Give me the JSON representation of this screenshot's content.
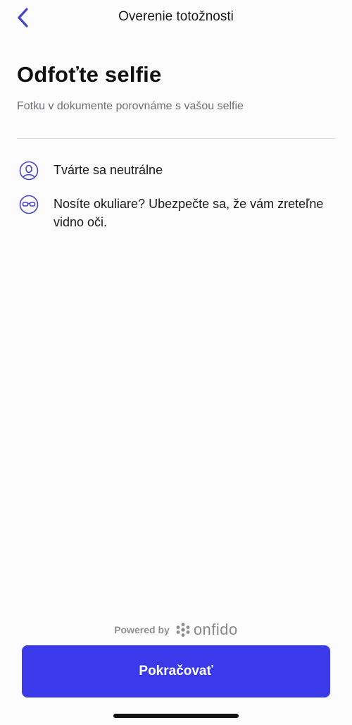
{
  "nav": {
    "title": "Overenie totožnosti",
    "back_icon": "chevron-left-icon"
  },
  "header": {
    "title": "Odfoťte selfie",
    "subtitle": "Fotku v dokumente porovnáme s vašou selfie"
  },
  "instructions": [
    {
      "icon": "face-icon",
      "text": "Tvárte sa neutrálne"
    },
    {
      "icon": "glasses-icon",
      "text": "Nosíte okuliare? Ubezpečte sa, že vám zreteľne vidno oči."
    }
  ],
  "footer": {
    "powered_by": "Powered by",
    "brand": "onfido",
    "continue_label": "Pokračovať"
  },
  "colors": {
    "accent": "#3a3aea",
    "icon": "#4444cc",
    "text_secondary": "#6e6e73"
  }
}
